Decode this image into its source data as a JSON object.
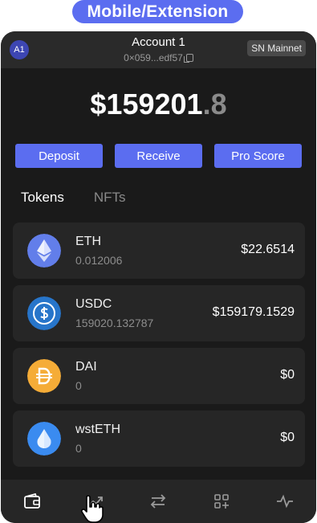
{
  "banner": {
    "label": "Mobile/Extension"
  },
  "header": {
    "avatar_text": "A1",
    "account_name": "Account 1",
    "address": "0×059...edf57",
    "network": "SN Mainnet"
  },
  "balance": {
    "whole": "$159201",
    "decimal": ".8"
  },
  "actions": {
    "deposit": "Deposit",
    "receive": "Receive",
    "pro_score": "Pro Score"
  },
  "tabs": [
    {
      "label": "Tokens",
      "active": true
    },
    {
      "label": "NFTs",
      "active": false
    }
  ],
  "tokens": [
    {
      "symbol": "ETH",
      "amount": "0.012006",
      "value": "$22.6514",
      "icon": "ethereum-icon",
      "color": "#627eea"
    },
    {
      "symbol": "USDC",
      "amount": "159020.132787",
      "value": "$159179.1529",
      "icon": "usdc-icon",
      "color": "#2775ca"
    },
    {
      "symbol": "DAI",
      "amount": "0",
      "value": "$0",
      "icon": "dai-icon",
      "color": "#f5ac37"
    },
    {
      "symbol": "wstETH",
      "amount": "0",
      "value": "$0",
      "icon": "wsteth-icon",
      "color": "#3a8bf0"
    }
  ],
  "nav": [
    "wallet-icon",
    "trend-icon",
    "swap-icon",
    "apps-icon",
    "activity-icon"
  ],
  "colors": {
    "accent": "#5b6df0",
    "background": "#1a1a1a",
    "card": "#262626"
  }
}
